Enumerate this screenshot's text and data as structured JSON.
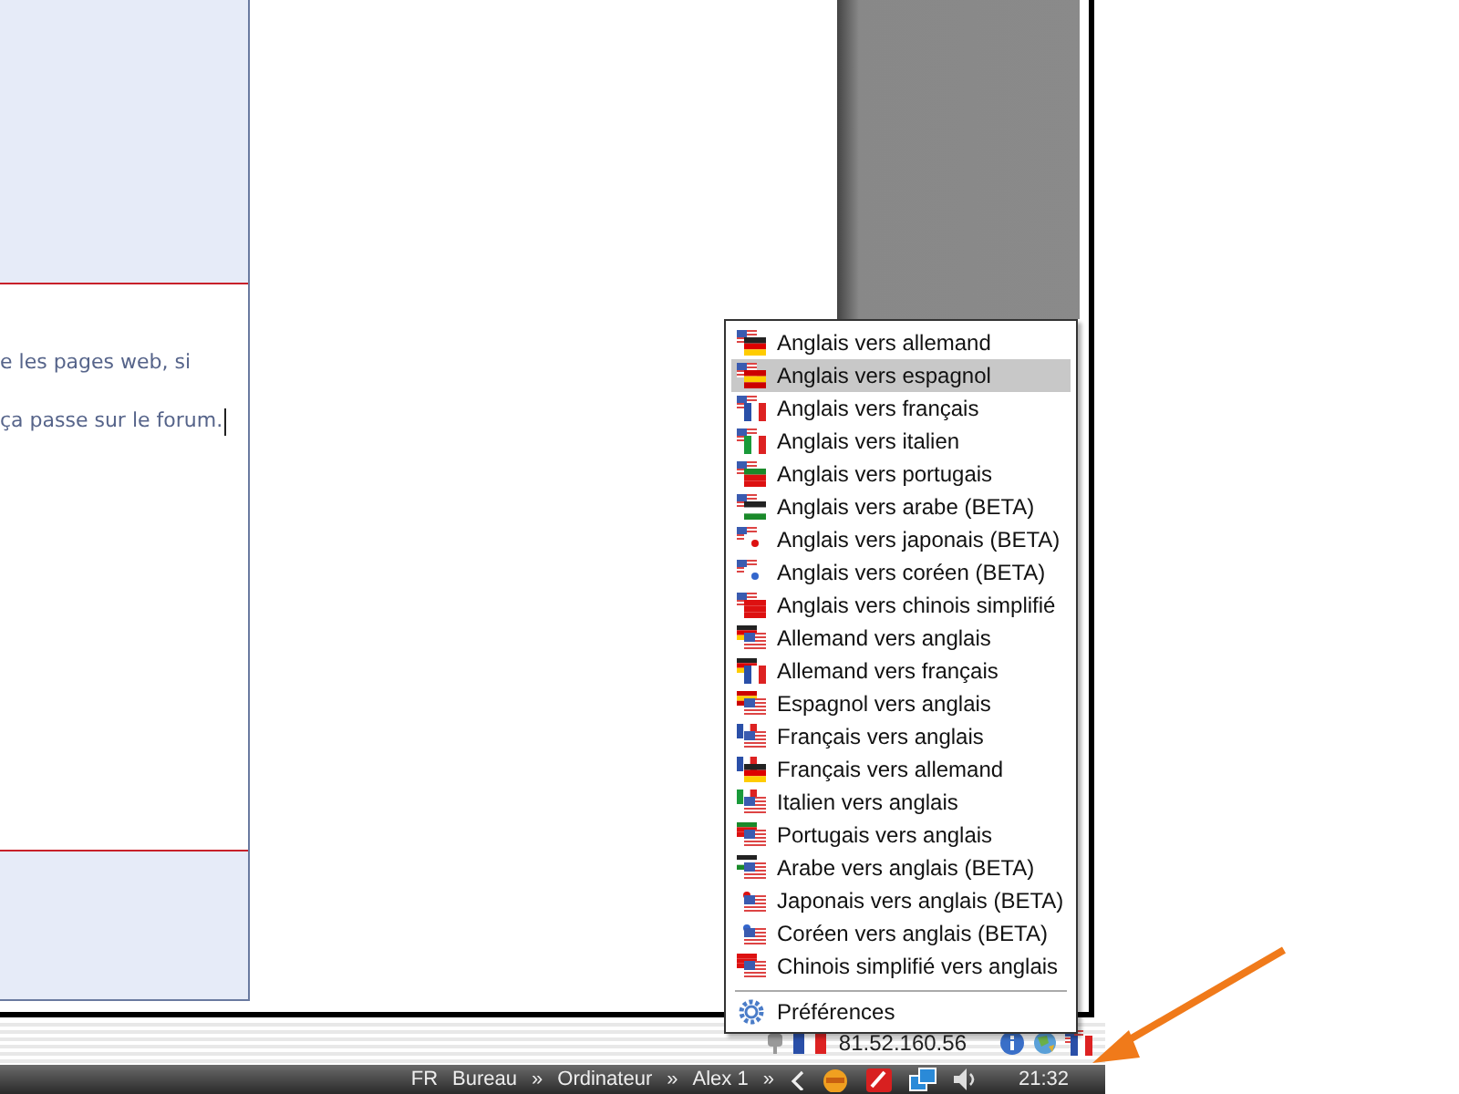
{
  "editor": {
    "lines": [
      "e les pages web, si",
      "ça passe sur le forum."
    ]
  },
  "menu": {
    "items": [
      {
        "label": "Anglais vers allemand",
        "selected": false
      },
      {
        "label": "Anglais vers espagnol",
        "selected": true
      },
      {
        "label": "Anglais vers français",
        "selected": false
      },
      {
        "label": "Anglais vers italien",
        "selected": false
      },
      {
        "label": "Anglais vers portugais",
        "selected": false
      },
      {
        "label": "Anglais vers arabe (BETA)",
        "selected": false
      },
      {
        "label": "Anglais vers japonais (BETA)",
        "selected": false
      },
      {
        "label": "Anglais vers coréen (BETA)",
        "selected": false
      },
      {
        "label": "Anglais vers chinois simplifié",
        "selected": false
      },
      {
        "label": "Allemand vers anglais",
        "selected": false
      },
      {
        "label": "Allemand vers français",
        "selected": false
      },
      {
        "label": "Espagnol vers anglais",
        "selected": false
      },
      {
        "label": "Français vers anglais",
        "selected": false
      },
      {
        "label": "Français vers allemand",
        "selected": false
      },
      {
        "label": "Italien vers anglais",
        "selected": false
      },
      {
        "label": "Portugais vers anglais",
        "selected": false
      },
      {
        "label": "Arabe vers anglais (BETA)",
        "selected": false
      },
      {
        "label": "Japonais vers anglais (BETA)",
        "selected": false
      },
      {
        "label": "Coréen vers anglais (BETA)",
        "selected": false
      },
      {
        "label": "Chinois simplifié vers anglais",
        "selected": false
      }
    ],
    "footer": {
      "label": "Préférences"
    }
  },
  "tray_bar": {
    "ip": "81.52.160.56"
  },
  "taskbar": {
    "items": [
      "FR",
      "Bureau",
      "»",
      "Ordinateur",
      "»",
      "Alex 1",
      "»"
    ],
    "clock": "21:32"
  }
}
